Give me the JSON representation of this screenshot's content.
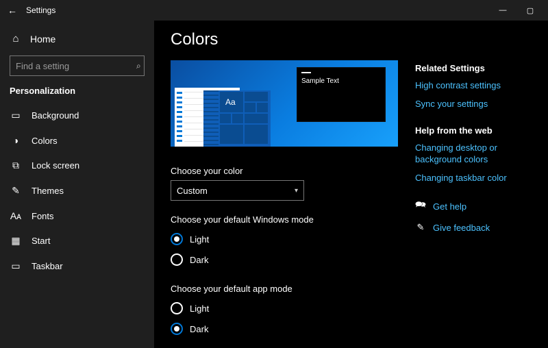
{
  "titlebar": {
    "back_glyph": "←",
    "title": "Settings",
    "min": "—",
    "max": "▢",
    "close": "✕"
  },
  "sidebar": {
    "home": "Home",
    "search_placeholder": "Find a setting",
    "section": "Personalization",
    "items": [
      {
        "icon": "background-icon",
        "glyph": "▭",
        "label": "Background"
      },
      {
        "icon": "colors-icon",
        "glyph": "◑",
        "label": "Colors"
      },
      {
        "icon": "lockscreen-icon",
        "glyph": "⧉",
        "label": "Lock screen"
      },
      {
        "icon": "themes-icon",
        "glyph": "✎",
        "label": "Themes"
      },
      {
        "icon": "fonts-icon",
        "glyph": "Aᴀ",
        "label": "Fonts"
      },
      {
        "icon": "start-icon",
        "glyph": "▦",
        "label": "Start"
      },
      {
        "icon": "taskbar-icon",
        "glyph": "▭",
        "label": "Taskbar"
      }
    ]
  },
  "page": {
    "title": "Colors",
    "preview": {
      "sample_text": "Sample Text",
      "aa": "Aa"
    },
    "choose_color_label": "Choose your color",
    "choose_color_value": "Custom",
    "windows_mode_label": "Choose your default Windows mode",
    "windows_mode_options": [
      "Light",
      "Dark"
    ],
    "windows_mode_selected": "Light",
    "app_mode_label": "Choose your default app mode",
    "app_mode_options": [
      "Light",
      "Dark"
    ],
    "app_mode_selected": "Dark"
  },
  "right": {
    "related_heading": "Related Settings",
    "related_links": [
      "High contrast settings",
      "Sync your settings"
    ],
    "help_heading": "Help from the web",
    "help_links": [
      "Changing desktop or background colors",
      "Changing taskbar color"
    ],
    "support": [
      {
        "icon": "help-icon",
        "glyph": "🗪",
        "label": "Get help"
      },
      {
        "icon": "feedback-icon",
        "glyph": "✎",
        "label": "Give feedback"
      }
    ]
  }
}
